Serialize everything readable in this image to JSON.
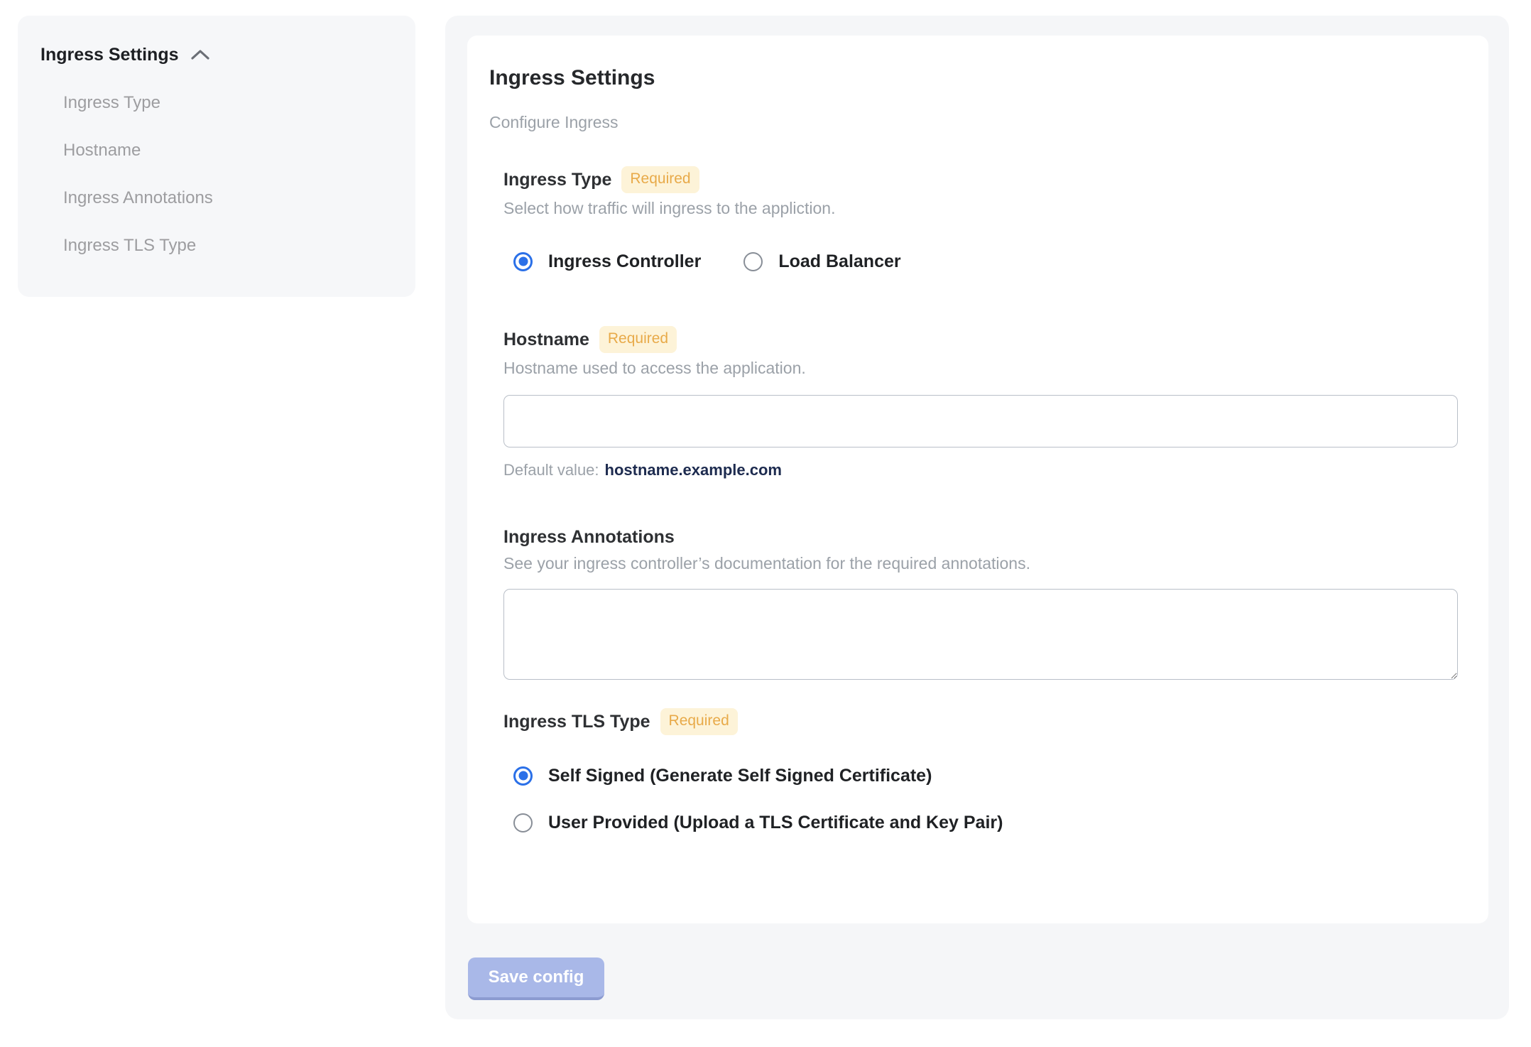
{
  "sidebar": {
    "header": "Ingress Settings",
    "items": [
      {
        "label": "Ingress Type"
      },
      {
        "label": "Hostname"
      },
      {
        "label": "Ingress Annotations"
      },
      {
        "label": "Ingress TLS Type"
      }
    ]
  },
  "form": {
    "title": "Ingress Settings",
    "subtitle": "Configure Ingress",
    "required_badge": "Required",
    "ingress_type": {
      "label": "Ingress Type",
      "help": "Select how traffic will ingress to the appliction.",
      "options": [
        {
          "label": "Ingress Controller",
          "selected": true
        },
        {
          "label": "Load Balancer",
          "selected": false
        }
      ]
    },
    "hostname": {
      "label": "Hostname",
      "help": "Hostname used to access the application.",
      "value": "",
      "default_label": "Default value:",
      "default_value": "hostname.example.com"
    },
    "annotations": {
      "label": "Ingress Annotations",
      "help": "See your ingress controller’s documentation for the required annotations.",
      "value": ""
    },
    "tls_type": {
      "label": "Ingress TLS Type",
      "options": [
        {
          "label": "Self Signed (Generate Self Signed Certificate)",
          "selected": true
        },
        {
          "label": "User Provided (Upload a TLS Certificate and Key Pair)",
          "selected": false
        }
      ]
    }
  },
  "actions": {
    "save_label": "Save config"
  },
  "colors": {
    "accent_blue": "#2b70e8",
    "badge_bg": "#fdf3d8",
    "badge_text": "#e8aa49",
    "panel_bg": "#f5f6f8",
    "default_value_text": "#1d2b4f",
    "save_button_bg": "#a9b8e8"
  }
}
